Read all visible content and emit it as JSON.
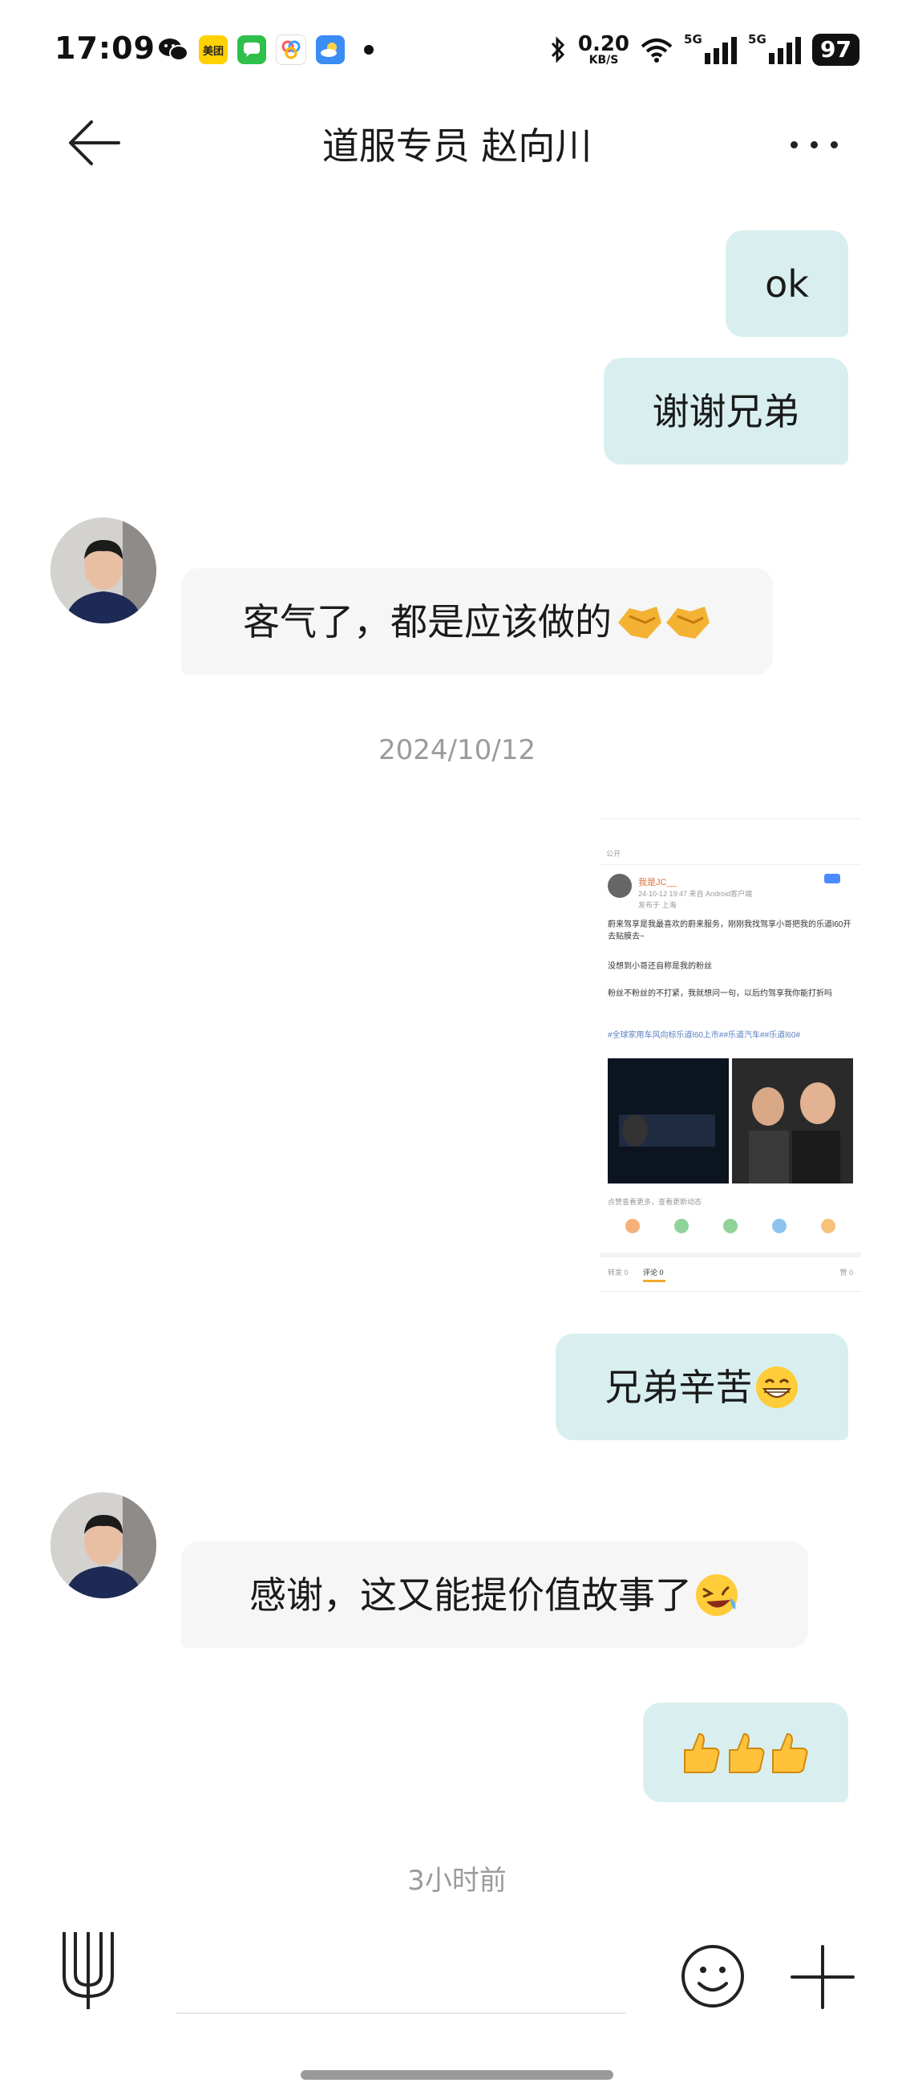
{
  "status_bar": {
    "time": "17:09",
    "meituan_label": "美团",
    "net_speed": "0.20",
    "net_unit": "KB/S",
    "signal1_label": "5G",
    "signal2_label": "5G",
    "battery": "97"
  },
  "header": {
    "title": "道服专员 赵向川"
  },
  "messages": [
    {
      "side": "out",
      "text": "ok"
    },
    {
      "side": "out",
      "text": "谢谢兄弟"
    },
    {
      "side": "in",
      "text": "客气了，都是应该做的"
    },
    {
      "side": "out",
      "text": "兄弟辛苦"
    },
    {
      "side": "in",
      "text": "感谢，这又能提价值故事了"
    },
    {
      "side": "out",
      "text": ""
    }
  ],
  "timestamps": [
    "2024/10/12",
    "3小时前"
  ],
  "shared_screenshot": {
    "visibility": "公开",
    "author": "我是JC__",
    "post_meta": "24-10-12 19:47 来自 Android客户端",
    "location": "发布于 上海",
    "para1": "蔚来驾享是我最喜欢的蔚来服务，刚刚我找驾享小哥把我的乐道l60开去贴膜去~",
    "para2": "没想到小哥还自称是我的粉丝",
    "para3": "粉丝不粉丝的不打紧，我就想问一句，以后约驾享我你能打折吗",
    "hashtags": "#全球家用车风向标乐道l60上市##乐道汽车##乐道l60#",
    "hint": "点赞查看更多，查看更新动态",
    "tab_forward": "转发 0",
    "tab_comment": "评论 0",
    "tab_like": "赞 0"
  },
  "colors": {
    "outgoing_bubble": "#d9efef",
    "incoming_bubble": "#f6f6f6",
    "timestamp": "#9b9b9b"
  },
  "icons": [
    "back-arrow-icon",
    "more-icon",
    "voice-icon",
    "emoji-icon",
    "plus-icon",
    "handshake-emoji",
    "grin-emoji",
    "laugh-emoji",
    "thumbs-up-emoji"
  ]
}
